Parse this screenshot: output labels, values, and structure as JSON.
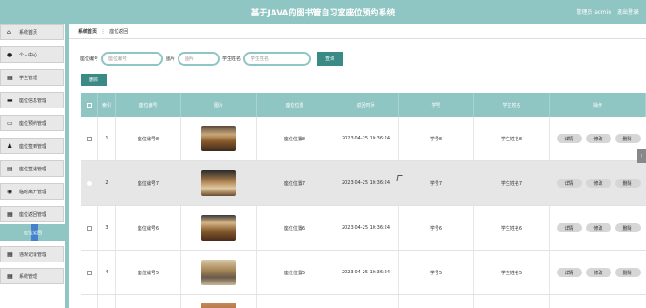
{
  "header": {
    "title": "基于JAVA的图书管自习室座位预约系统",
    "user_label": "管理员 admin",
    "logout_label": "退出登录"
  },
  "sidebar": {
    "items": [
      {
        "label": "系统首页",
        "icon": "home-icon"
      },
      {
        "label": "个人中心",
        "icon": "person-icon"
      },
      {
        "label": "学生管理",
        "icon": "grid-icon"
      },
      {
        "label": "座位信息管理",
        "icon": "card-icon"
      },
      {
        "label": "座位预约管理",
        "icon": "monitor-icon"
      },
      {
        "label": "座位签到管理",
        "icon": "user-icon"
      },
      {
        "label": "座位签退管理",
        "icon": "printer-icon"
      },
      {
        "label": "临时离开管理",
        "icon": "location-icon"
      },
      {
        "label": "座位返回管理",
        "icon": "grid-icon"
      }
    ],
    "active_sub": {
      "label": "座位返回"
    },
    "items_after": [
      {
        "label": "违规记录管理",
        "icon": "grid-icon"
      },
      {
        "label": "系统管理",
        "icon": "grid-icon"
      }
    ]
  },
  "breadcrumb": {
    "home": "系统首页",
    "separator": "⋮",
    "current": "座位返回"
  },
  "search": {
    "seat_no_label": "座位编号",
    "seat_no_placeholder": "座位编号",
    "image_label": "图片",
    "image_placeholder": "图片",
    "student_name_label": "学生姓名",
    "student_name_placeholder": "学生姓名",
    "query_button": "查询"
  },
  "delete_button": "删除",
  "table": {
    "headers": [
      "",
      "索引",
      "座位编号",
      "图片",
      "座位位置",
      "返回时间",
      "学号",
      "学生姓名",
      "操作"
    ],
    "rows": [
      {
        "index": "1",
        "seat_no": "座位编号8",
        "position": "座位位置8",
        "time": "2023-04-25 10:36:24",
        "student_no": "学号8",
        "student_name": "学生姓名8"
      },
      {
        "index": "2",
        "seat_no": "座位编号7",
        "position": "座位位置7",
        "time": "2023-04-25 10:36:24",
        "student_no": "学号7",
        "student_name": "学生姓名7"
      },
      {
        "index": "3",
        "seat_no": "座位编号6",
        "position": "座位位置6",
        "time": "2023-04-25 10:36:24",
        "student_no": "学号6",
        "student_name": "学生姓名6"
      },
      {
        "index": "4",
        "seat_no": "座位编号5",
        "position": "座位位置5",
        "time": "2023-04-25 10:36:24",
        "student_no": "学号5",
        "student_name": "学生姓名5"
      }
    ],
    "actions": {
      "detail": "详情",
      "edit": "修改",
      "delete": "删除"
    }
  },
  "colors": {
    "accent": "#8fc5c2",
    "button": "#3a8a85",
    "highlight_row": "#e6e6e6"
  }
}
